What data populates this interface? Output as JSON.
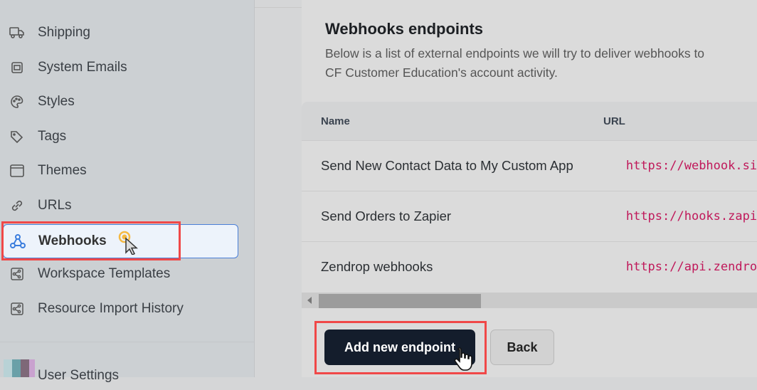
{
  "sidebar": {
    "items": [
      {
        "label": "Shipping",
        "icon": "truck-icon"
      },
      {
        "label": "System Emails",
        "icon": "mail-icon"
      },
      {
        "label": "Styles",
        "icon": "palette-icon"
      },
      {
        "label": "Tags",
        "icon": "tag-icon"
      },
      {
        "label": "Themes",
        "icon": "window-icon"
      },
      {
        "label": "URLs",
        "icon": "link-icon"
      },
      {
        "label": "Webhooks",
        "icon": "webhook-icon",
        "active": true
      },
      {
        "label": "Workspace Templates",
        "icon": "share-icon"
      },
      {
        "label": "Resource Import History",
        "icon": "share-icon"
      }
    ],
    "user_settings": "User Settings"
  },
  "main": {
    "title": "Webhooks endpoints",
    "description_line1": "Below is a list of external endpoints we will try to deliver webhooks to",
    "description_line2": "CF Customer Education's account activity.",
    "table": {
      "headers": [
        "Name",
        "URL"
      ],
      "rows": [
        {
          "name": "Send New Contact Data to My Custom App",
          "url": "https://webhook.si"
        },
        {
          "name": "Send Orders to Zapier",
          "url": "https://hooks.zapi"
        },
        {
          "name": "Zendrop webhooks",
          "url": "https://api.zendro"
        }
      ]
    },
    "add_button": "Add new endpoint",
    "back_button": "Back"
  },
  "colors": {
    "accent": "#4a7fd8",
    "highlight": "#f04848",
    "url": "#c0185a",
    "primary_button": "#141d2c"
  }
}
